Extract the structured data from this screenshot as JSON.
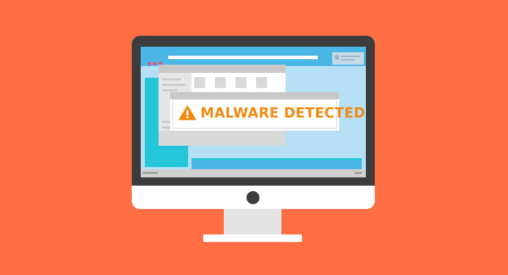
{
  "alert": {
    "message": "MALWARE DETECTED!",
    "icon": "warning-icon",
    "color": "#f08a13"
  },
  "colors": {
    "background": "#ff6e42",
    "bezel": "#3c3c3c",
    "screen_blue": "#4ab6e6",
    "screen_light": "#b7e0f7",
    "accent_teal": "#26c6da",
    "window_dot": "#f04a6a"
  }
}
